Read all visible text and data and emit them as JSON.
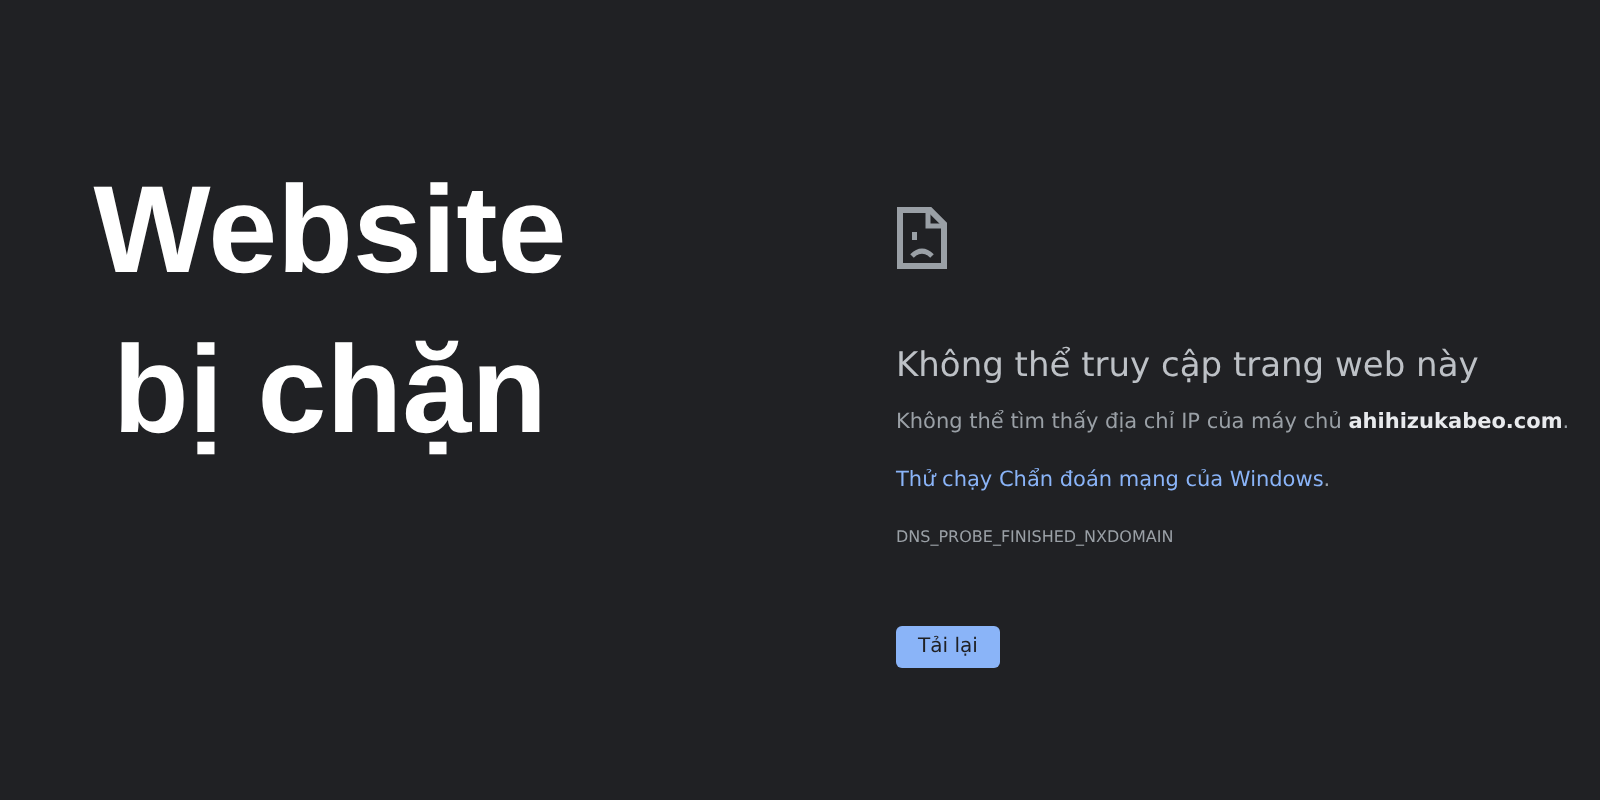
{
  "headline": "Website bị chặn",
  "error_page": {
    "title": "Không thể truy cập trang web này",
    "description": "Không thể tìm thấy địa chỉ IP của máy chủ **ahihizukabeo.com**.",
    "link": "Thử chạy Chẩn đoán mạng của Windows",
    "link_suffix": ".",
    "error_code": "DNS_PROBE_FINISHED_NXDOMAIN",
    "button": "Tải lại"
  }
}
